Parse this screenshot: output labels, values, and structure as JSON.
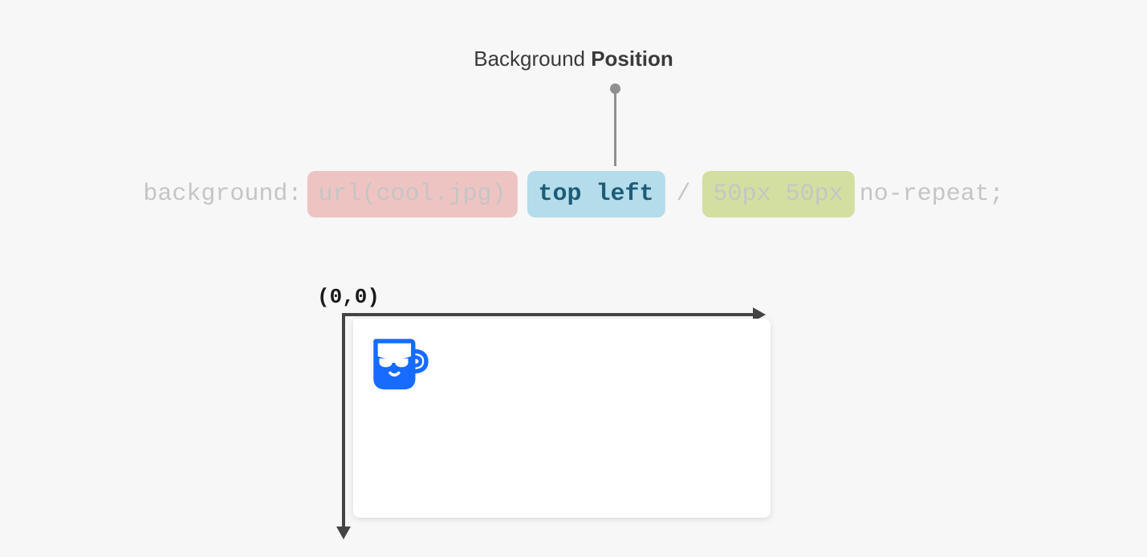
{
  "title": {
    "prefix": "Background ",
    "bold": "Position"
  },
  "code": {
    "property": "background: ",
    "url": "url(cool.jpg)",
    "position": "top left",
    "slash": "/",
    "size": "50px 50px",
    "repeat": "no-repeat;"
  },
  "origin_label": "(0,0)",
  "colors": {
    "highlight_red": "#eec4c3",
    "highlight_blue": "#b5dcea",
    "highlight_green": "#d3dfa0",
    "icon_blue": "#176bff",
    "axis": "#444444",
    "connector": "#909090"
  }
}
